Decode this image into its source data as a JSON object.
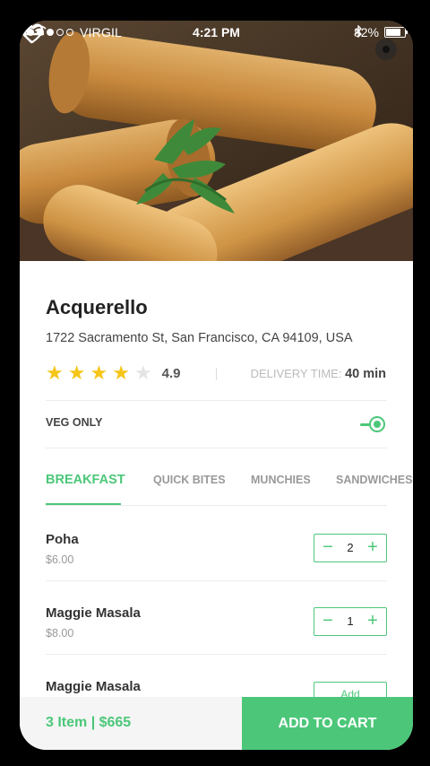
{
  "status_bar": {
    "carrier": "VIRGIL",
    "time": "4:21 PM",
    "battery": "82%"
  },
  "restaurant": {
    "name": "Acquerello",
    "address": "1722 Sacramento St, San Francisco, CA 94109, USA",
    "rating": "4.9",
    "stars_filled": 4,
    "stars_total": 5,
    "delivery_label": "DELIVERY TIME:",
    "delivery_value": "40 min"
  },
  "filter": {
    "veg_only_label": "VEG ONLY",
    "veg_only_on": true
  },
  "tabs": [
    {
      "label": "BREAKFAST",
      "active": true
    },
    {
      "label": "QUICK BITES",
      "active": false
    },
    {
      "label": "MUNCHIES",
      "active": false
    },
    {
      "label": "SANDWICHES",
      "active": false
    }
  ],
  "menu_items": [
    {
      "name": "Poha",
      "price": "$6.00",
      "quantity": "2"
    },
    {
      "name": "Maggie Masala",
      "price": "$8.00",
      "quantity": "1"
    },
    {
      "name": "Maggie Masala",
      "add_label": "Add"
    }
  ],
  "cart": {
    "summary": "3 Item | $665",
    "cta_label": "ADD TO CART"
  },
  "colors": {
    "accent": "#4cc779",
    "star": "#f5c518"
  }
}
